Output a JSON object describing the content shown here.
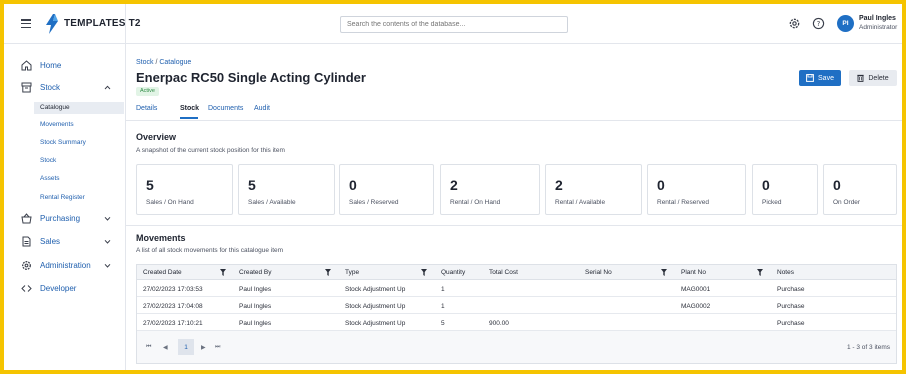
{
  "app": {
    "brand": "TEMPLATES T2",
    "search_placeholder": "Search the contents of the database...",
    "user": {
      "initials": "PI",
      "name": "Paul Ingles",
      "role": "Administrator"
    }
  },
  "sidebar": {
    "items": [
      {
        "label": "Home",
        "icon": "home-icon"
      },
      {
        "label": "Stock",
        "icon": "stock-icon",
        "expanded": true
      },
      {
        "label": "Purchasing",
        "icon": "basket-icon"
      },
      {
        "label": "Sales",
        "icon": "document-icon"
      },
      {
        "label": "Administration",
        "icon": "gear-icon"
      },
      {
        "label": "Developer",
        "icon": "code-icon"
      }
    ],
    "stock_children": [
      "Catalogue",
      "Movements",
      "Stock Summary",
      "Stock",
      "Assets",
      "Rental Register"
    ],
    "active_child": "Catalogue"
  },
  "page": {
    "breadcrumb_parent": "Stock",
    "breadcrumb_child": "Catalogue",
    "title": "Enerpac RC50 Single Acting Cylinder",
    "status": "Active",
    "save_label": "Save",
    "delete_label": "Delete",
    "tabs": [
      "Details",
      "Stock",
      "Documents",
      "Audit"
    ],
    "active_tab": "Stock"
  },
  "overview": {
    "title": "Overview",
    "subtitle": "A snapshot of the current stock position for this item",
    "cards": [
      {
        "value": "5",
        "label": "Sales / On Hand"
      },
      {
        "value": "5",
        "label": "Sales / Available"
      },
      {
        "value": "0",
        "label": "Sales / Reserved"
      },
      {
        "value": "2",
        "label": "Rental / On Hand"
      },
      {
        "value": "2",
        "label": "Rental / Available"
      },
      {
        "value": "0",
        "label": "Rental / Reserved"
      },
      {
        "value": "0",
        "label": "Picked"
      },
      {
        "value": "0",
        "label": "On Order"
      }
    ]
  },
  "movements": {
    "title": "Movements",
    "subtitle": "A list of all stock movements for this catalogue item",
    "columns": [
      "Created Date",
      "Created By",
      "Type",
      "Quantity",
      "Total Cost",
      "Serial No",
      "Plant No",
      "Notes"
    ],
    "rows": [
      [
        "27/02/2023 17:03:53",
        "Paul Ingles",
        "Stock Adjustment Up",
        "1",
        "",
        "",
        "MAG0001",
        "Purchase"
      ],
      [
        "27/02/2023 17:04:08",
        "Paul Ingles",
        "Stock Adjustment Up",
        "1",
        "",
        "",
        "MAG0002",
        "Purchase"
      ],
      [
        "27/02/2023 17:10:21",
        "Paul Ingles",
        "Stock Adjustment Up",
        "5",
        "900.00",
        "",
        "",
        "Purchase"
      ]
    ],
    "pager": {
      "current_page": "1",
      "info": "1 - 3 of 3 items",
      "first": "⏮",
      "prev": "◀",
      "next": "▶",
      "last": "⏭"
    }
  },
  "colors": {
    "accent": "#1f6fc4",
    "frame": "#f5c400",
    "active_badge": "#2e8b44"
  }
}
